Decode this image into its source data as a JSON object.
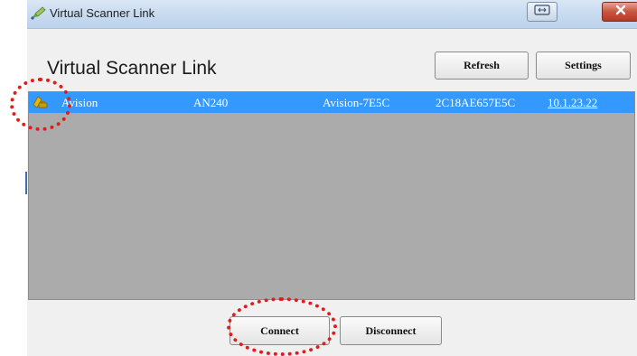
{
  "window": {
    "title": "Virtual Scanner Link",
    "icon": "pen-link-icon",
    "controls": [
      "restore-icon",
      "close-icon"
    ]
  },
  "header": {
    "heading": "Virtual Scanner Link",
    "refresh_label": "Refresh",
    "settings_label": "Settings"
  },
  "device_list": {
    "rows": [
      {
        "icon": "scanner-device-icon",
        "name": "Avision",
        "model": "AN240",
        "host": "Avision-7E5C",
        "mac": "2C18AE657E5C",
        "ip": "10.1.23.22",
        "selected": true
      }
    ]
  },
  "footer": {
    "connect_label": "Connect",
    "disconnect_label": "Disconnect"
  },
  "colors": {
    "selection": "#3399ff",
    "list_background": "#ababab",
    "annotation": "#e41b1b",
    "close_button": "#c8553f"
  }
}
